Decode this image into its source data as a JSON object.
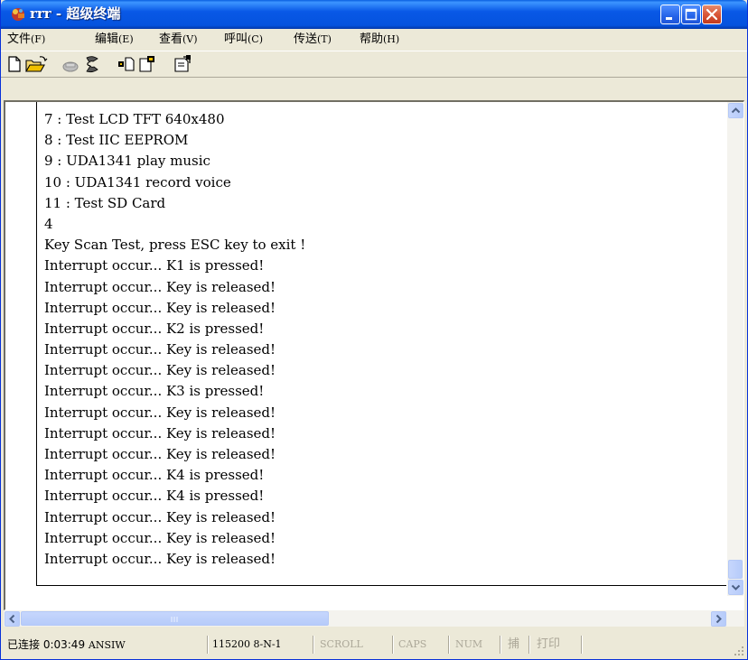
{
  "window": {
    "title": "rrr - 超级终端"
  },
  "menu": [
    {
      "label": "文件",
      "mnemonic": "(F)"
    },
    {
      "label": "编辑",
      "mnemonic": "(E)"
    },
    {
      "label": "查看",
      "mnemonic": "(V)"
    },
    {
      "label": "呼叫",
      "mnemonic": "(C)"
    },
    {
      "label": "传送",
      "mnemonic": "(T)"
    },
    {
      "label": "帮助",
      "mnemonic": "(H)"
    }
  ],
  "toolbar": {
    "icons": [
      "new-icon",
      "open-icon",
      "call-icon",
      "disconnect-icon",
      "send-icon",
      "receive-icon",
      "properties-icon"
    ]
  },
  "terminal": {
    "lines": [
      "7 : Test LCD TFT 640x480",
      "8 : Test IIC EEPROM",
      "9 : UDA1341 play music",
      "10 : UDA1341 record voice",
      "11 : Test SD Card",
      "4",
      "Key Scan Test, press ESC key to exit !",
      "Interrupt occur... K1 is pressed!",
      "Interrupt occur... Key is released!",
      "Interrupt occur... Key is released!",
      "Interrupt occur... K2 is pressed!",
      "Interrupt occur... Key is released!",
      "Interrupt occur... Key is released!",
      "Interrupt occur... K3 is pressed!",
      "Interrupt occur... Key is released!",
      "Interrupt occur... Key is released!",
      "Interrupt occur... Key is released!",
      "Interrupt occur... K4 is pressed!",
      "Interrupt occur... K4 is pressed!",
      "Interrupt occur... Key is released!",
      "Interrupt occur... Key is released!",
      "Interrupt occur... Key is released!"
    ]
  },
  "statusbar": {
    "connection": "已连接 0:03:49",
    "emulation": "ANSIW",
    "settings": "115200 8-N-1",
    "scroll": "SCROLL",
    "caps": "CAPS",
    "num": "NUM",
    "capture": "捕",
    "print": "打印"
  },
  "colors": {
    "titlebar": "#0553de",
    "chrome": "#ece9d8",
    "terminal_bg": "#ffffff",
    "close_button": "#d9573a"
  }
}
